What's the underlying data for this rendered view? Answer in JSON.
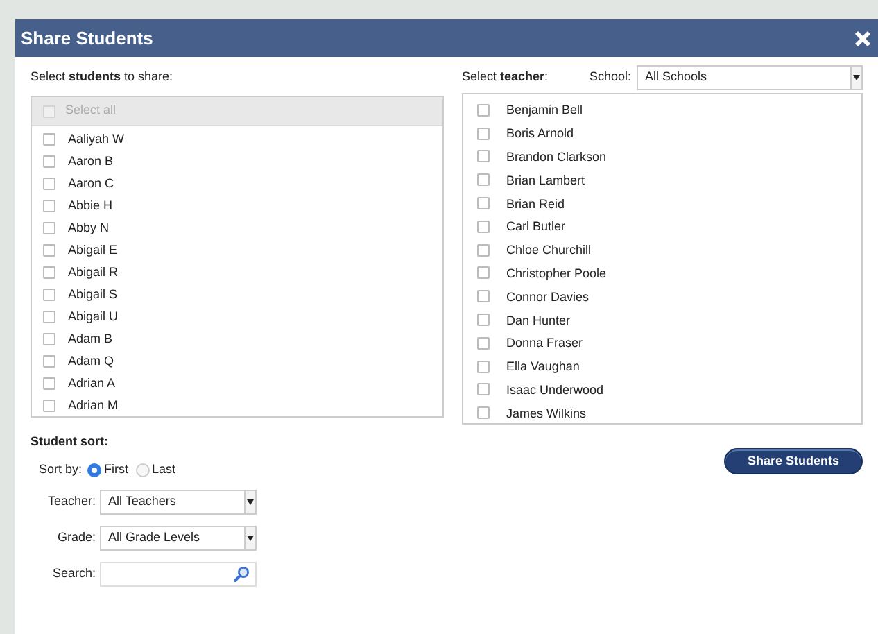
{
  "dialog": {
    "title": "Share Students"
  },
  "students": {
    "label": "Select **students** to share:",
    "select_all": {
      "label": "Select all",
      "checked": false,
      "disabled": true
    },
    "items": [
      {
        "name": "Aaliyah W",
        "checked": false
      },
      {
        "name": "Aaron B",
        "checked": false
      },
      {
        "name": "Aaron C",
        "checked": false
      },
      {
        "name": "Abbie H",
        "checked": false
      },
      {
        "name": "Abby N",
        "checked": false
      },
      {
        "name": "Abigail E",
        "checked": false
      },
      {
        "name": "Abigail R",
        "checked": false
      },
      {
        "name": "Abigail S",
        "checked": false
      },
      {
        "name": "Abigail U",
        "checked": false
      },
      {
        "name": "Adam B",
        "checked": false
      },
      {
        "name": "Adam Q",
        "checked": false
      },
      {
        "name": "Adrian A",
        "checked": false
      },
      {
        "name": "Adrian M",
        "checked": false
      }
    ]
  },
  "teachers": {
    "label": "Select **teacher**:",
    "school": {
      "label": "School:",
      "value": "All Schools"
    },
    "items": [
      {
        "name": "Benjamin Bell",
        "checked": false
      },
      {
        "name": "Boris Arnold",
        "checked": false
      },
      {
        "name": "Brandon Clarkson",
        "checked": false
      },
      {
        "name": "Brian Lambert",
        "checked": false
      },
      {
        "name": "Brian Reid",
        "checked": false
      },
      {
        "name": "Carl Butler",
        "checked": false
      },
      {
        "name": "Chloe Churchill",
        "checked": false
      },
      {
        "name": "Christopher Poole",
        "checked": false
      },
      {
        "name": "Connor Davies",
        "checked": false
      },
      {
        "name": "Dan Hunter",
        "checked": false
      },
      {
        "name": "Donna Fraser",
        "checked": false
      },
      {
        "name": "Ella Vaughan",
        "checked": false
      },
      {
        "name": "Isaac Underwood",
        "checked": false
      },
      {
        "name": "James Wilkins",
        "checked": false
      }
    ]
  },
  "sort": {
    "heading": "Student sort:",
    "sort_by": {
      "label": "Sort by:",
      "options": [
        {
          "label": "First",
          "selected": true
        },
        {
          "label": "Last",
          "selected": false
        }
      ]
    },
    "filters": [
      {
        "kind": "select",
        "label": "Teacher:",
        "value": "All Teachers"
      },
      {
        "kind": "select",
        "label": "Grade:",
        "value": "All Grade Levels"
      },
      {
        "kind": "search",
        "label": "Search:"
      }
    ]
  },
  "share_button": "Share Students"
}
